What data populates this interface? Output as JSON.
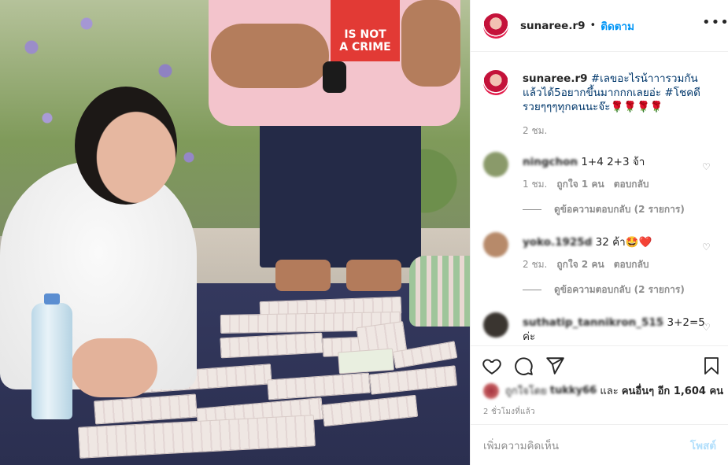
{
  "photo": {
    "shirt_text": "IS NOT\nA CRIME"
  },
  "header": {
    "username": "sunaree.r9",
    "dot": "•",
    "follow_label": "ติดตาม",
    "more_icon": "more-horizontal-icon"
  },
  "caption": {
    "username": "sunaree.r9",
    "text": "#เลขอะไรน้าาารวมกันแล้วได้5อยากขึ้นมากกกเลยอ่ะ #โชคดีรวยๆๆๆทุกคนนะจ๊ะ🌹🌹🌹🌹",
    "time": "2 ชม."
  },
  "comments": [
    {
      "username": "ningchon",
      "text": "1+4 2+3 จ้า",
      "time": "1 ชม.",
      "likes": "ถูกใจ 1 คน",
      "reply": "ตอบกลับ",
      "view_replies": "ดูข้อความตอบกลับ (2 รายการ)",
      "avatar_color": "#8a9a6a"
    },
    {
      "username": "yoko.1925d",
      "text": "32 ค้า🤩❤️",
      "time": "2 ชม.",
      "likes": "ถูกใจ 2 คน",
      "reply": "ตอบกลับ",
      "view_replies": "ดูข้อความตอบกลับ (2 รายการ)",
      "avatar_color": "#b78a6a"
    },
    {
      "username": "suthatip_tannikron_515",
      "text": "3+2=5 ค่ะ",
      "avatar_color": "#3a3530"
    }
  ],
  "actions": {
    "like_icon": "heart-icon",
    "comment_icon": "comment-icon",
    "share_icon": "share-icon",
    "save_icon": "bookmark-icon"
  },
  "likes": {
    "prefix": "ถูกใจโดย",
    "user": "tukky66",
    "suffix": "และ",
    "others": "คนอื่นๆ อีก 1,604 คน"
  },
  "timeago": "2 ชั่วโมงที่แล้ว",
  "add_comment": {
    "placeholder": "เพิ่มความคิดเห็น",
    "post_label": "โพสต์"
  },
  "colors": {
    "accent": "#0095f6",
    "caption_link": "#00376b",
    "muted": "#8e8e8e",
    "post_disabled": "#b2dffc"
  }
}
